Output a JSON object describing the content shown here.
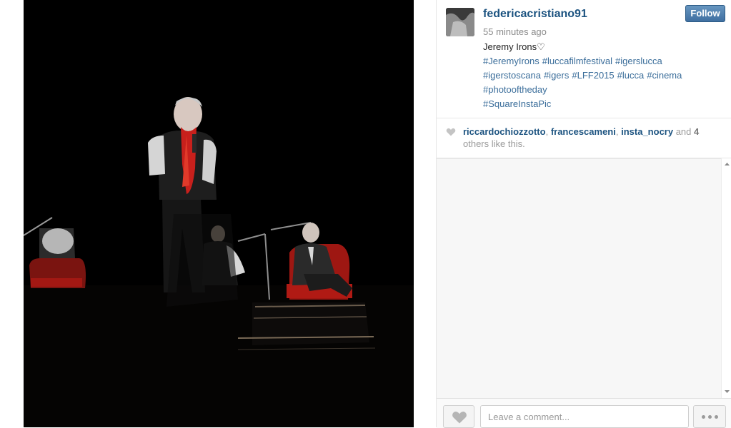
{
  "post": {
    "username": "federicacristiano91",
    "timestamp": "55 minutes ago",
    "follow_label": "Follow",
    "caption_text": "Jeremy Irons♡",
    "hashtags": [
      "#JeremyIrons",
      "#luccafilmfestival",
      "#igerslucca",
      "#igerstoscana",
      "#igers",
      "#LFF2015",
      "#lucca",
      "#cinema",
      "#photooftheday",
      "#SquareInstaPic"
    ]
  },
  "likes": {
    "users": [
      "riccardochiozzotto",
      "francescameni",
      "insta_nocry"
    ],
    "sep1": ", ",
    "sep2": ", ",
    "and_text": " and ",
    "others_count": "4",
    "suffix": " others like this."
  },
  "comment_box": {
    "placeholder": "Leave a comment..."
  },
  "icons": {
    "heart": "heart-icon",
    "more": "more-dots-icon",
    "scroll_up": "scroll-up-arrow-icon",
    "scroll_down": "scroll-down-arrow-icon"
  },
  "colors": {
    "username": "#1c5380",
    "hashtag": "#3a6d9a",
    "follow_button": "#4a7bac",
    "scarf_red": "#c8201c"
  }
}
